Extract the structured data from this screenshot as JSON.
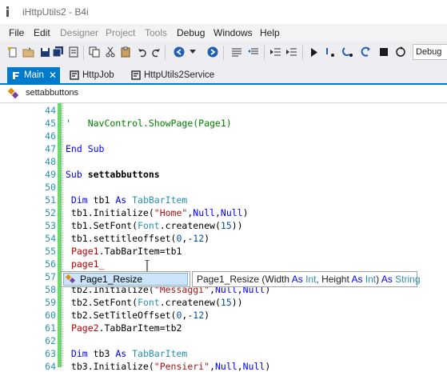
{
  "window": {
    "title": "iHttpUtils2 - B4i"
  },
  "menu": [
    "File",
    "Edit",
    "Designer",
    "Project",
    "Tools",
    "Debug",
    "Windows",
    "Help"
  ],
  "toolbar": {
    "config_value": "Debug"
  },
  "tabs": [
    {
      "label": "Main"
    },
    {
      "label": "HttpJob"
    },
    {
      "label": "HttpUtils2Service"
    }
  ],
  "subbar": {
    "label": "settabbuttons"
  },
  "editor": {
    "lines": [
      {
        "n": "44",
        "segs": []
      },
      {
        "n": "45",
        "segs": [
          {
            "t": "'   NavControl.ShowPage(Page1)",
            "c": "cm"
          }
        ]
      },
      {
        "n": "46",
        "segs": []
      },
      {
        "n": "47",
        "segs": [
          {
            "t": "End Sub",
            "c": "kw"
          }
        ]
      },
      {
        "n": "48",
        "segs": []
      },
      {
        "n": "49",
        "segs": [
          {
            "t": "Sub ",
            "c": "kw"
          },
          {
            "t": "settabbuttons",
            "c": "bold"
          }
        ]
      },
      {
        "n": "50",
        "segs": []
      },
      {
        "n": "51",
        "segs": [
          {
            "t": " Dim ",
            "c": "kw"
          },
          {
            "t": "tb1 "
          },
          {
            "t": "As ",
            "c": "kw"
          },
          {
            "t": "TabBarItem",
            "c": "ty"
          }
        ]
      },
      {
        "n": "52",
        "segs": [
          {
            "t": " tb1.Initialize("
          },
          {
            "t": "\"Home\"",
            "c": "str"
          },
          {
            "t": ","
          },
          {
            "t": "Null",
            "c": "kw"
          },
          {
            "t": ","
          },
          {
            "t": "Null",
            "c": "kw"
          },
          {
            "t": ")"
          }
        ]
      },
      {
        "n": "53",
        "segs": [
          {
            "t": " tb1.SetFont("
          },
          {
            "t": "Font",
            "c": "ty"
          },
          {
            "t": ".createnew("
          },
          {
            "t": "15",
            "c": "nm"
          },
          {
            "t": "))"
          }
        ]
      },
      {
        "n": "54",
        "segs": [
          {
            "t": " tb1.settitleoffset("
          },
          {
            "t": "0",
            "c": "nm"
          },
          {
            "t": ",-"
          },
          {
            "t": "12",
            "c": "nm"
          },
          {
            "t": ")"
          }
        ]
      },
      {
        "n": "55",
        "segs": [
          {
            "t": " "
          },
          {
            "t": "Page1",
            "c": "red"
          },
          {
            "t": ".TabBarItem=tb1"
          }
        ]
      },
      {
        "n": "56",
        "segs": [
          {
            "t": " "
          },
          {
            "t": "page1_",
            "c": "red"
          }
        ]
      },
      {
        "n": "57",
        "segs": []
      },
      {
        "n": "58",
        "segs": [
          {
            "t": " tb2.Initialize("
          },
          {
            "t": "\"Messaggi\"",
            "c": "str"
          },
          {
            "t": ","
          },
          {
            "t": "Null",
            "c": "kw"
          },
          {
            "t": ","
          },
          {
            "t": "Null",
            "c": "kw"
          },
          {
            "t": ")"
          }
        ]
      },
      {
        "n": "59",
        "segs": [
          {
            "t": " tb2.SetFont("
          },
          {
            "t": "Font",
            "c": "ty"
          },
          {
            "t": ".createnew("
          },
          {
            "t": "15",
            "c": "nm"
          },
          {
            "t": "))"
          }
        ]
      },
      {
        "n": "60",
        "segs": [
          {
            "t": " tb2.SetTitleOffset("
          },
          {
            "t": "0",
            "c": "nm"
          },
          {
            "t": ",-"
          },
          {
            "t": "12",
            "c": "nm"
          },
          {
            "t": ")"
          }
        ]
      },
      {
        "n": "61",
        "segs": [
          {
            "t": " "
          },
          {
            "t": "Page2",
            "c": "red"
          },
          {
            "t": ".TabBarItem=tb2"
          }
        ]
      },
      {
        "n": "62",
        "segs": []
      },
      {
        "n": "63",
        "segs": [
          {
            "t": " Dim ",
            "c": "kw"
          },
          {
            "t": "tb3 "
          },
          {
            "t": "As ",
            "c": "kw"
          },
          {
            "t": "TabBarItem",
            "c": "ty"
          }
        ]
      },
      {
        "n": "64",
        "segs": [
          {
            "t": " tb3.Initialize("
          },
          {
            "t": "\"Pensieri\"",
            "c": "str"
          },
          {
            "t": ","
          },
          {
            "t": "Null",
            "c": "kw"
          },
          {
            "t": ","
          },
          {
            "t": "Null",
            "c": "kw"
          },
          {
            "t": ")"
          }
        ]
      }
    ]
  },
  "autocomplete": {
    "item": "Page1_Resize",
    "tooltip_segs": [
      {
        "t": "Page1_Resize (Width "
      },
      {
        "t": "As ",
        "c": "kw"
      },
      {
        "t": "Int",
        "c": "ty"
      },
      {
        "t": ", Height "
      },
      {
        "t": "As ",
        "c": "kw"
      },
      {
        "t": "Int",
        "c": "ty"
      },
      {
        "t": ") "
      },
      {
        "t": "As ",
        "c": "kw"
      },
      {
        "t": "String",
        "c": "ty"
      }
    ]
  },
  "colors": {
    "accent": "#007acc",
    "changebar": "#6fd66f",
    "line_number": "#2b91af"
  }
}
